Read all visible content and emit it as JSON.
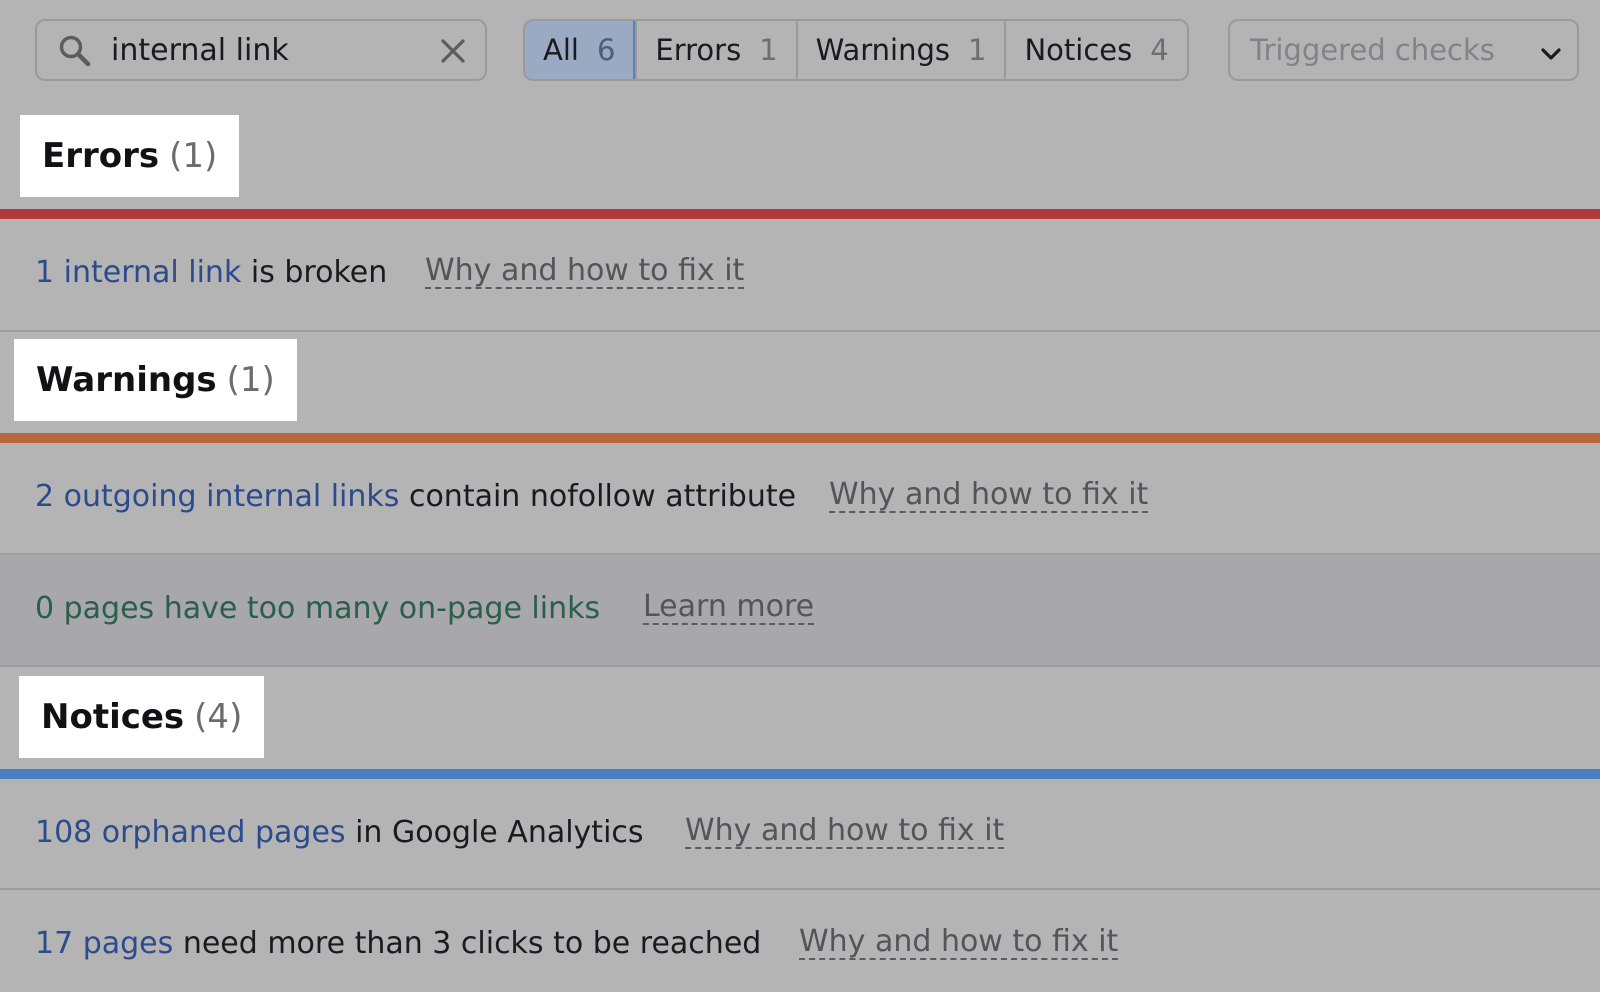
{
  "search": {
    "value": "internal link",
    "icon": "search-icon",
    "clear_icon": "close-icon"
  },
  "filters": [
    {
      "label": "All",
      "count": "6",
      "active": true
    },
    {
      "label": "Errors",
      "count": "1"
    },
    {
      "label": "Warnings",
      "count": "1"
    },
    {
      "label": "Notices",
      "count": "4"
    }
  ],
  "dropdown": {
    "label": "Triggered checks",
    "icon": "chevron-down-icon"
  },
  "sections": {
    "errors": {
      "title": "Errors",
      "count": "(1)",
      "color": "#b23a3c",
      "rows": [
        {
          "link": "1 internal link",
          "text": " is broken",
          "action": "Why and how to fix it"
        }
      ]
    },
    "warnings": {
      "title": "Warnings",
      "count": "(1)",
      "color": "#b8693a",
      "rows": [
        {
          "link": "2 outgoing internal links",
          "text": " contain nofollow attribute",
          "action": "Why and how to fix it"
        },
        {
          "text": "0 pages have too many on-page links",
          "action": "Learn more"
        }
      ]
    },
    "notices": {
      "title": "Notices",
      "count": "(4)",
      "color": "#4c7fc0",
      "rows": [
        {
          "link": "108 orphaned pages",
          "text": " in Google Analytics",
          "action": "Why and how to fix it"
        },
        {
          "link": "17 pages",
          "text": " need more than 3 clicks to be reached",
          "action": "Why and how to fix it"
        }
      ]
    }
  }
}
